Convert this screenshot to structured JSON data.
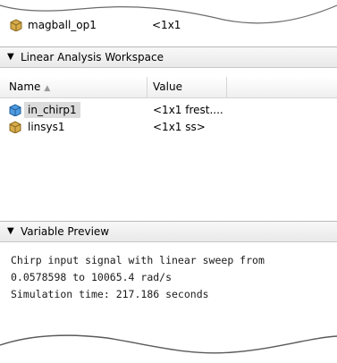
{
  "top_row": {
    "name": "magball_op1",
    "value": "<1x1"
  },
  "workspace": {
    "title": "Linear Analysis Workspace",
    "columns": {
      "name": "Name",
      "value": "Value"
    },
    "rows": [
      {
        "name": "in_chirp1",
        "value": "<1x1 frest....",
        "selected": true,
        "icon": "chirp-object-icon"
      },
      {
        "name": "linsys1",
        "value": "<1x1 ss>",
        "selected": false,
        "icon": "object-icon"
      }
    ]
  },
  "preview": {
    "title": "Variable Preview",
    "lines": [
      "Chirp input signal with linear sweep from",
      "0.0578598 to 10065.4 rad/s",
      "Simulation time: 217.186 seconds"
    ]
  },
  "colors": {
    "selection": "#dcdcdc",
    "header_bg": "#eeeeee",
    "chirp_icon": "#3b8fd8",
    "object_icon": "#c49a3c"
  }
}
